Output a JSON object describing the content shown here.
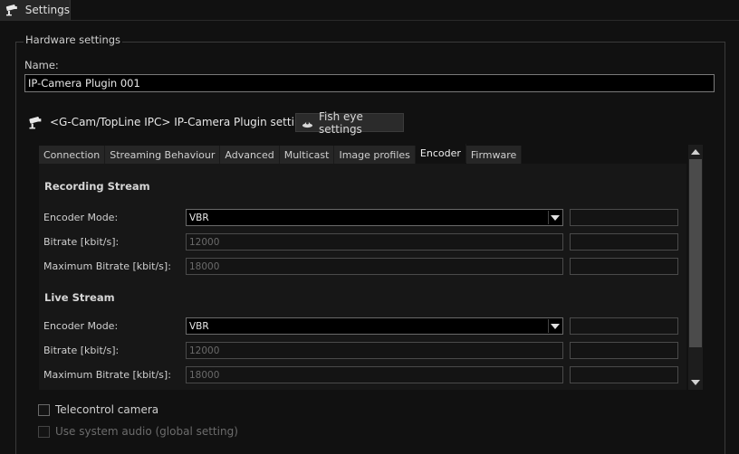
{
  "window": {
    "tab_title": "Settings",
    "tab_icon": "security-camera-icon"
  },
  "hardware": {
    "group_title": "Hardware settings",
    "name_label": "Name:",
    "name_value": "IP-Camera Plugin 001"
  },
  "plugin": {
    "tab_label": "<G-Cam/TopLine IPC> IP-Camera Plugin settings",
    "tab_icon": "security-camera-icon",
    "fisheye_label": "Fish eye settings",
    "fisheye_icon": "fisheye-camera-icon"
  },
  "subtabs": [
    {
      "label": "Connection",
      "active": false
    },
    {
      "label": "Streaming Behaviour",
      "active": false
    },
    {
      "label": "Advanced",
      "active": false
    },
    {
      "label": "Multicast",
      "active": false
    },
    {
      "label": "Image profiles",
      "active": false
    },
    {
      "label": "Encoder",
      "active": true
    },
    {
      "label": "Firmware",
      "active": false
    }
  ],
  "recording": {
    "title": "Recording Stream",
    "encoder_mode_label": "Encoder Mode:",
    "encoder_mode_value": "VBR",
    "bitrate_label": "Bitrate [kbit/s]:",
    "bitrate_placeholder": "12000",
    "max_bitrate_label": "Maximum Bitrate [kbit/s]:",
    "max_bitrate_placeholder": "18000"
  },
  "live": {
    "title": "Live Stream",
    "encoder_mode_label": "Encoder Mode:",
    "encoder_mode_value": "VBR",
    "bitrate_label": "Bitrate [kbit/s]:",
    "bitrate_placeholder": "12000",
    "max_bitrate_label": "Maximum Bitrate [kbit/s]:",
    "max_bitrate_placeholder": "18000"
  },
  "options": {
    "telecontrol_label": "Telecontrol camera",
    "telecontrol_checked": false,
    "system_audio_label": "Use system audio (global setting)",
    "system_audio_checked": false
  },
  "colors": {
    "background": "#111111",
    "panel": "#171717",
    "border": "#3a3a3a",
    "text": "#cfcfcf"
  }
}
